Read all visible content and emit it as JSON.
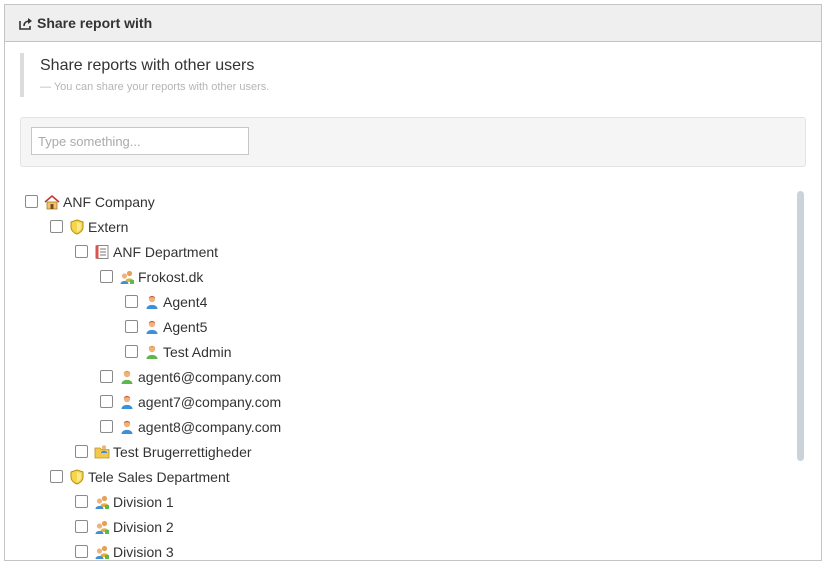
{
  "header": {
    "title": "Share report with",
    "icon": "share-icon"
  },
  "callout": {
    "title": "Share reports with other users",
    "subtitle": "— You can share your reports with other users."
  },
  "search": {
    "placeholder": "Type something...",
    "value": ""
  },
  "tree": {
    "items": [
      {
        "label": "ANF Company",
        "icon": "house-icon",
        "depth": 0,
        "checked": false
      },
      {
        "label": "Extern",
        "icon": "shield-icon",
        "depth": 1,
        "checked": false
      },
      {
        "label": "ANF Department",
        "icon": "notebook-icon",
        "depth": 2,
        "checked": false
      },
      {
        "label": "Frokost.dk",
        "icon": "group-icon",
        "depth": 3,
        "checked": false
      },
      {
        "label": "Agent4",
        "icon": "user-icon",
        "depth": 4,
        "checked": false
      },
      {
        "label": "Agent5",
        "icon": "user-icon",
        "depth": 4,
        "checked": false
      },
      {
        "label": "Test Admin",
        "icon": "admin-user-icon",
        "depth": 4,
        "checked": false
      },
      {
        "label": "agent6@company.com",
        "icon": "admin-user-icon",
        "depth": 3,
        "checked": false
      },
      {
        "label": "agent7@company.com",
        "icon": "user-icon",
        "depth": 3,
        "checked": false
      },
      {
        "label": "agent8@company.com",
        "icon": "user-icon",
        "depth": 3,
        "checked": false
      },
      {
        "label": "Test Brugerrettigheder",
        "icon": "folder-user-icon",
        "depth": 2,
        "checked": false
      },
      {
        "label": "Tele Sales Department",
        "icon": "shield-icon",
        "depth": 1,
        "checked": false
      },
      {
        "label": "Division 1",
        "icon": "group-icon",
        "depth": 2,
        "checked": false
      },
      {
        "label": "Division 2",
        "icon": "group-icon",
        "depth": 2,
        "checked": false
      },
      {
        "label": "Division 3",
        "icon": "group-icon",
        "depth": 2,
        "checked": false
      }
    ]
  },
  "colors": {
    "header_bg": "#efefef",
    "border": "#c4c4c4",
    "well_bg": "#f5f5f5",
    "scrollbar": "#c9d3d9"
  }
}
